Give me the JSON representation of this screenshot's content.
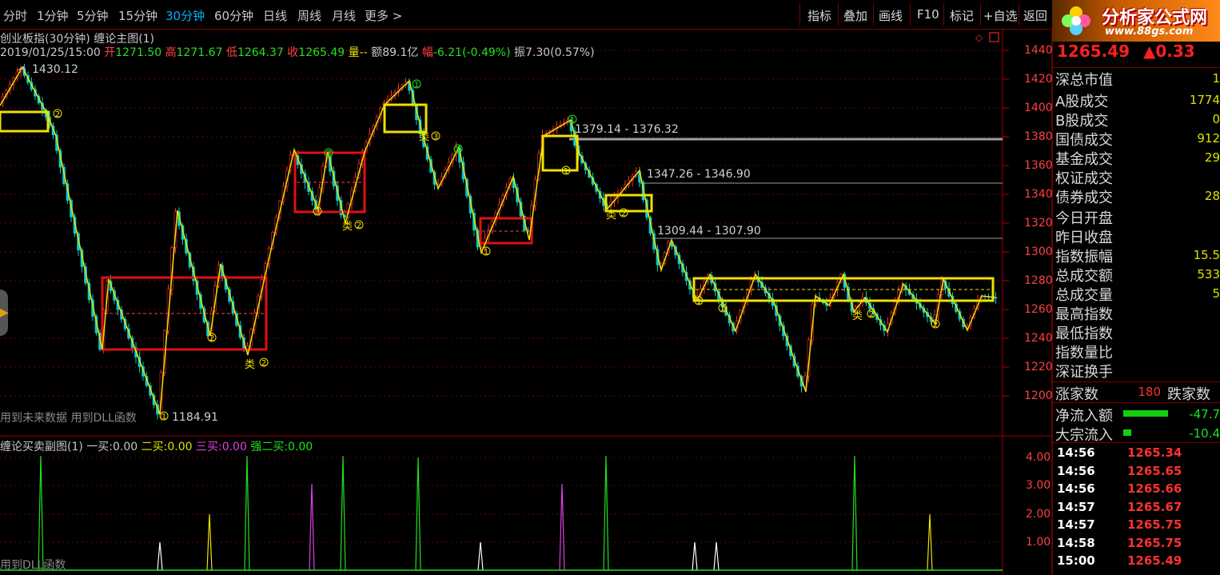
{
  "toolbar": {
    "timeframes": [
      "分时",
      "1分钟",
      "5分钟",
      "15分钟",
      "30分钟",
      "60分钟",
      "日线",
      "周线",
      "月线",
      "更多 >"
    ],
    "active_timeframe": "30分钟",
    "tools": [
      "指标",
      "叠加",
      "画线",
      "F10",
      "标记",
      "+自选",
      "返回"
    ]
  },
  "chart_title": "创业板指(30分钟) 缠论主图(1)",
  "ohlc": {
    "datetime": "2019/01/25/15:00",
    "open_label": "开",
    "open": "1271.50",
    "high_label": "高",
    "high": "1271.67",
    "low_label": "低",
    "low": "1264.37",
    "close_label": "收",
    "close": "1265.49",
    "volume_label": "量--",
    "amount_label": "额",
    "amount": "89.1亿",
    "change_label": "幅",
    "change": "-6.21(-0.49%)",
    "amplitude_label": "振",
    "amplitude": "7.30(0.57%)"
  },
  "annotations": {
    "high": "1430.12",
    "low": "1184.91",
    "level1": "1379.14 - 1376.32",
    "level2": "1347.26 - 1346.90",
    "level3": "1309.44 - 1307.90"
  },
  "notes": {
    "main": "用到未来数据 用到DLL函数",
    "sub": "用到DLL函数"
  },
  "price_axis": [
    "1440",
    "1420",
    "1400",
    "1380",
    "1360",
    "1340",
    "1320",
    "1300",
    "1280",
    "1260",
    "1240",
    "1220",
    "1200"
  ],
  "sub_axis": [
    "4.00",
    "3.00",
    "2.00",
    "1.00"
  ],
  "sub_indicator": {
    "name": "缠论买卖副图(1)",
    "buy1_label": "一买:",
    "buy1": "0.00",
    "buy2_label": "二买:",
    "buy2": "0.00",
    "buy3_label": "三买:",
    "buy3": "0.00",
    "sbuy2_label": "强二买:",
    "sbuy2": "0.00"
  },
  "right_panel": {
    "logo_name": "分析家公式网",
    "logo_url": "www.88gs.com",
    "price": "1265.49",
    "change": "▲0.33",
    "stats": [
      {
        "label": "深总市值",
        "value": "1"
      },
      {
        "label": "A股成交",
        "value": "1774"
      },
      {
        "label": "B股成交",
        "value": "0"
      },
      {
        "label": "国债成交",
        "value": "912"
      },
      {
        "label": "基金成交",
        "value": "29"
      },
      {
        "label": "权证成交",
        "value": ""
      },
      {
        "label": "债券成交",
        "value": "28"
      },
      {
        "label": "今日开盘",
        "value": ""
      },
      {
        "label": "昨日收盘",
        "value": ""
      },
      {
        "label": "指数振幅",
        "value": "15.5"
      },
      {
        "label": "总成交额",
        "value": "533"
      },
      {
        "label": "总成交量",
        "value": "5"
      },
      {
        "label": "最高指数",
        "value": ""
      },
      {
        "label": "最低指数",
        "value": ""
      },
      {
        "label": "指数量比",
        "value": ""
      },
      {
        "label": "深证换手",
        "value": ""
      }
    ],
    "up_label": "涨家数",
    "up_value": "180",
    "down_label": "跌家数",
    "net_inflow_label": "净流入额",
    "net_inflow": "-47.7",
    "block_inflow_label": "大宗流入",
    "block_inflow": "-10.4",
    "ticks": [
      {
        "time": "14:56",
        "price": "1265.34"
      },
      {
        "time": "14:56",
        "price": "1265.65"
      },
      {
        "time": "14:56",
        "price": "1265.66"
      },
      {
        "time": "14:57",
        "price": "1265.67"
      },
      {
        "time": "14:57",
        "price": "1265.75"
      },
      {
        "time": "14:58",
        "price": "1265.75"
      },
      {
        "time": "15:00",
        "price": "1265.49"
      }
    ]
  },
  "colors": {
    "up": "#ff3030",
    "down": "#00d0d0",
    "zhongshu_red": "#e01010",
    "zhongshu_yellow": "#f0e000",
    "grid": "#7a0000"
  }
}
